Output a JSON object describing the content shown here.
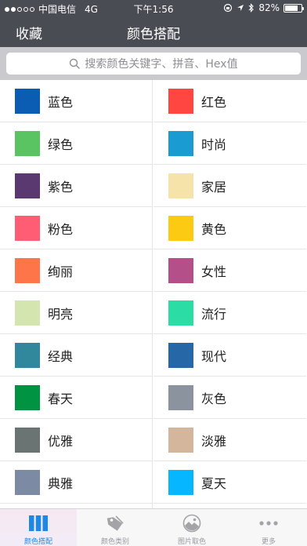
{
  "status_bar": {
    "carrier": "中国电信",
    "network": "4G",
    "time": "下午1:56",
    "battery": "82%",
    "battery_level": 0.82,
    "signal_bars": 2
  },
  "nav": {
    "favorites_label": "收藏",
    "title": "颜色搭配"
  },
  "search": {
    "placeholder": "搜索颜色关键字、拼音、Hex值"
  },
  "categories": [
    {
      "label": "蓝色",
      "color": "#0a5db3"
    },
    {
      "label": "红色",
      "color": "#ff4641"
    },
    {
      "label": "绿色",
      "color": "#5ac462"
    },
    {
      "label": "时尚",
      "color": "#1a9bd1"
    },
    {
      "label": "紫色",
      "color": "#59396f"
    },
    {
      "label": "家居",
      "color": "#f5e3aa"
    },
    {
      "label": "粉色",
      "color": "#ff5d74"
    },
    {
      "label": "黄色",
      "color": "#fcca12"
    },
    {
      "label": "绚丽",
      "color": "#ff754a"
    },
    {
      "label": "女性",
      "color": "#b54f8a"
    },
    {
      "label": "明亮",
      "color": "#d5e5b0"
    },
    {
      "label": "流行",
      "color": "#2cdca5"
    },
    {
      "label": "经典",
      "color": "#31879b"
    },
    {
      "label": "现代",
      "color": "#2567a7"
    },
    {
      "label": "春天",
      "color": "#009342"
    },
    {
      "label": "灰色",
      "color": "#8b939f"
    },
    {
      "label": "优雅",
      "color": "#6a7573"
    },
    {
      "label": "淡雅",
      "color": "#d3b69c"
    },
    {
      "label": "典雅",
      "color": "#7d8aa3"
    },
    {
      "label": "夏天",
      "color": "#06b7ff"
    }
  ],
  "tabs": [
    {
      "label": "颜色搭配",
      "icon": "columns-icon",
      "active": true
    },
    {
      "label": "颜色类别",
      "icon": "tag-icon",
      "active": false
    },
    {
      "label": "图片取色",
      "icon": "image-picker-icon",
      "active": false
    },
    {
      "label": "更多",
      "icon": "more-dots-icon",
      "active": false
    }
  ],
  "colors": {
    "nav_bg": "#4a4c53",
    "accent": "#1e88e5"
  }
}
